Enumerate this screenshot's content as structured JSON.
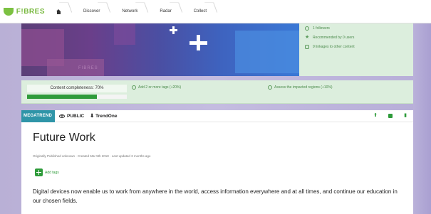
{
  "nav": {
    "logo_text": "F!BRES",
    "crumbs": [
      "Discover",
      "Network",
      "Radar",
      "Collect"
    ]
  },
  "hero": {
    "watermark": "FIBRES"
  },
  "stats": [
    {
      "icon": "people-icon",
      "text": "1 followers"
    },
    {
      "icon": "star-icon",
      "text": "Recommended by 0 users"
    },
    {
      "icon": "link-icon",
      "text": "9 linkages to other content"
    }
  ],
  "completeness": {
    "label": "Content completeness: 70%",
    "percent": 70,
    "tips": [
      "Add 2 or more tags (+20%)",
      "Assess the impacted regions (+10%)"
    ]
  },
  "card": {
    "badge": "MEGATREND",
    "visibility": "PUBLIC",
    "author": "TrendOne",
    "title": "Future Work",
    "meta": "Originally Published unknown · Created Mar 5th 2018 · Last updated 3 months ago",
    "add_tags": "Add tags",
    "description": "Digital devices now enable us to work from anywhere in the world, access information everywhere and at all times, and continue our education in our chosen fields."
  },
  "colors": {
    "brand_green": "#77b83d",
    "accent_green": "#2e9b3a",
    "badge_teal": "#2f95a8",
    "panel_green": "#dceedd"
  }
}
